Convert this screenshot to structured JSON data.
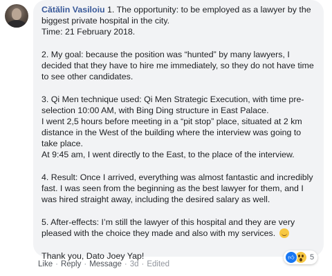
{
  "comment": {
    "author": "Cătălin Vasiloiu",
    "paragraphs": [
      {
        "lines": [
          " 1. The opportunity: to be employed as a lawyer by the biggest private hospital in the city.",
          "Time: 21 February 2018."
        ]
      },
      {
        "lines": [
          "2. My goal: because the position was “hunted” by many lawyers, I decided that they have to hire me immediately, so they do not have time to see other candidates."
        ]
      },
      {
        "lines": [
          "3. Qi Men technique used: Qi Men Strategic Execution, with time pre-selection 10:00 AM, with Bing Ding structure in East Palace.",
          "I went 2,5 hours before meeting in a “pit stop” place, situated at 2 km distance in the West of the building where the interview was going to take place.",
          "At 9:45 am, I went directly to the East, to the place of the interview."
        ]
      },
      {
        "lines": [
          "4. Result: Once I arrived, everything was almost fantastic and incredibly fast. I was seen from the beginning as the best lawyer for them, and I was hired straight away, including the desired salary as well."
        ]
      },
      {
        "lines": [
          "5. After-effects: I’m still the lawyer of this hospital and they are very pleased with the choice they made and also with my services. "
        ],
        "trailing_emoji": "smile-emoji"
      },
      {
        "lines": [
          "Thank you, Dato Joey Yap!"
        ]
      }
    ]
  },
  "actions": {
    "like": "Like",
    "reply": "Reply",
    "message": "Message",
    "age": "3d",
    "edited": "Edited",
    "separator": "·"
  },
  "reactions": {
    "icons": [
      "like-icon",
      "wow-icon"
    ],
    "count": "5",
    "like_color": "#1877f2",
    "wow_color": "#f7c843"
  },
  "colors": {
    "author": "#385898",
    "bubble": "#f2f3f5",
    "meta": "#90949c"
  }
}
